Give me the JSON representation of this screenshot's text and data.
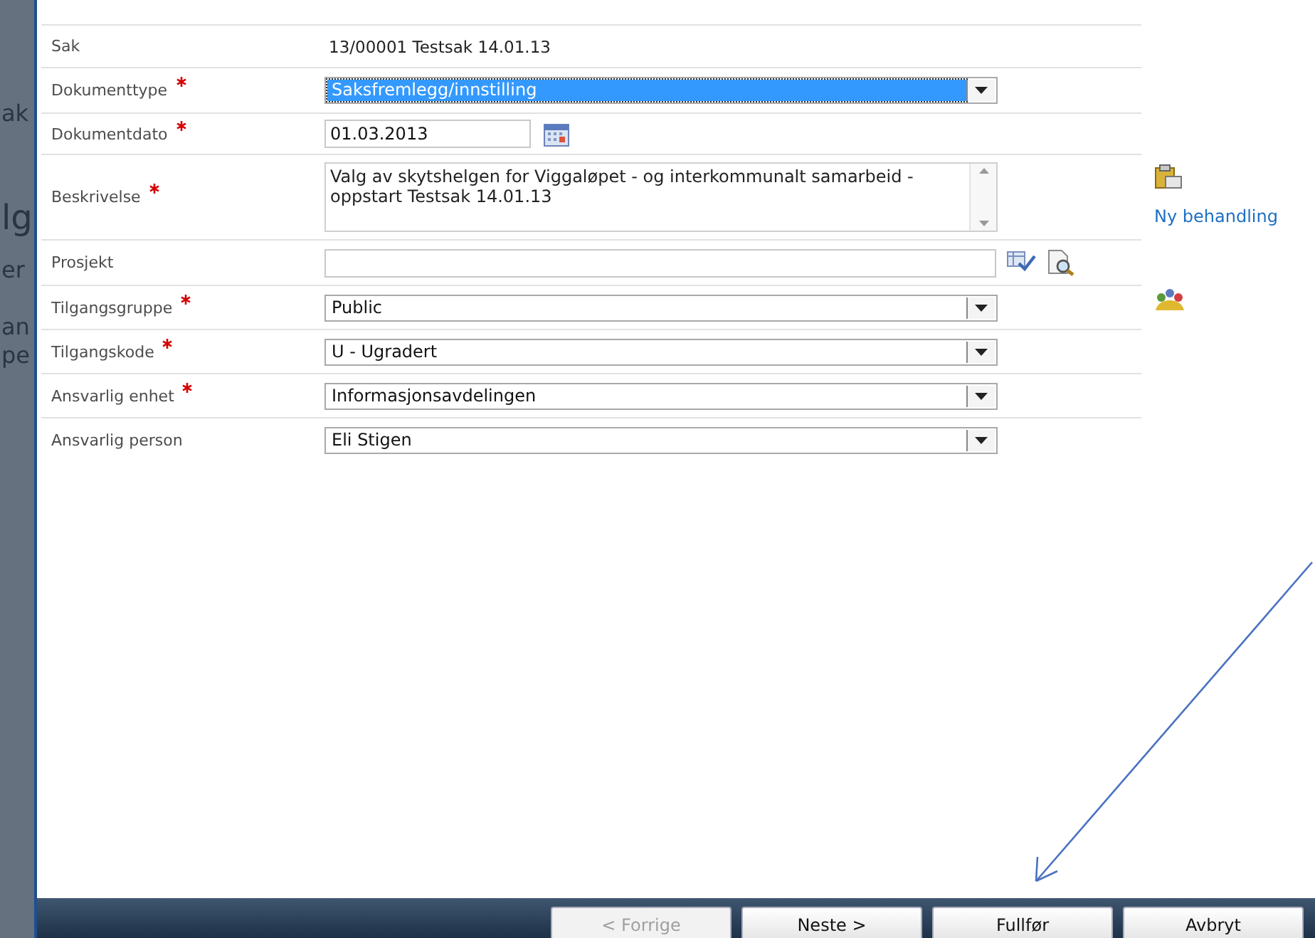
{
  "background_page": {
    "fragments": [
      {
        "text": "ak",
        "kind": "text"
      },
      {
        "text": "lg",
        "kind": "heading"
      },
      {
        "text": "er",
        "kind": "text"
      },
      {
        "text": "an",
        "kind": "text"
      },
      {
        "text": "pe",
        "kind": "text"
      }
    ]
  },
  "form": {
    "rows": [
      {
        "label": "Sak",
        "required": false,
        "kind": "text",
        "value": "13/00001 Testsak 14.01.13"
      },
      {
        "label": "Dokumenttype",
        "required": true,
        "kind": "select",
        "value": "Saksfremlegg/innstilling",
        "focused": true
      },
      {
        "label": "Dokumentdato",
        "required": true,
        "kind": "date",
        "value": "01.03.2013"
      },
      {
        "label": "Beskrivelse",
        "required": true,
        "kind": "textarea",
        "value": "Valg av skytshelgen for Viggaløpet - og interkommunalt samarbeid - oppstart Testsak 14.01.13"
      },
      {
        "label": "Prosjekt",
        "required": false,
        "kind": "lookup",
        "value": ""
      },
      {
        "label": "Tilgangsgruppe",
        "required": true,
        "kind": "select",
        "value": "Public",
        "focused": false
      },
      {
        "label": "Tilgangskode",
        "required": true,
        "kind": "select",
        "value": "U - Ugradert",
        "focused": false
      },
      {
        "label": "Ansvarlig enhet",
        "required": true,
        "kind": "select",
        "value": "Informasjonsavdelingen",
        "focused": false
      },
      {
        "label": "Ansvarlig person",
        "required": false,
        "kind": "select",
        "value": "Eli Stigen",
        "focused": false
      }
    ]
  },
  "side_actions": {
    "link": "Ny behandling"
  },
  "footer": {
    "buttons": [
      {
        "label": "< Forrige",
        "disabled": true
      },
      {
        "label": "Neste >",
        "disabled": false
      },
      {
        "label": "Fullfør",
        "disabled": false
      },
      {
        "label": "Avbryt",
        "disabled": false
      }
    ]
  }
}
